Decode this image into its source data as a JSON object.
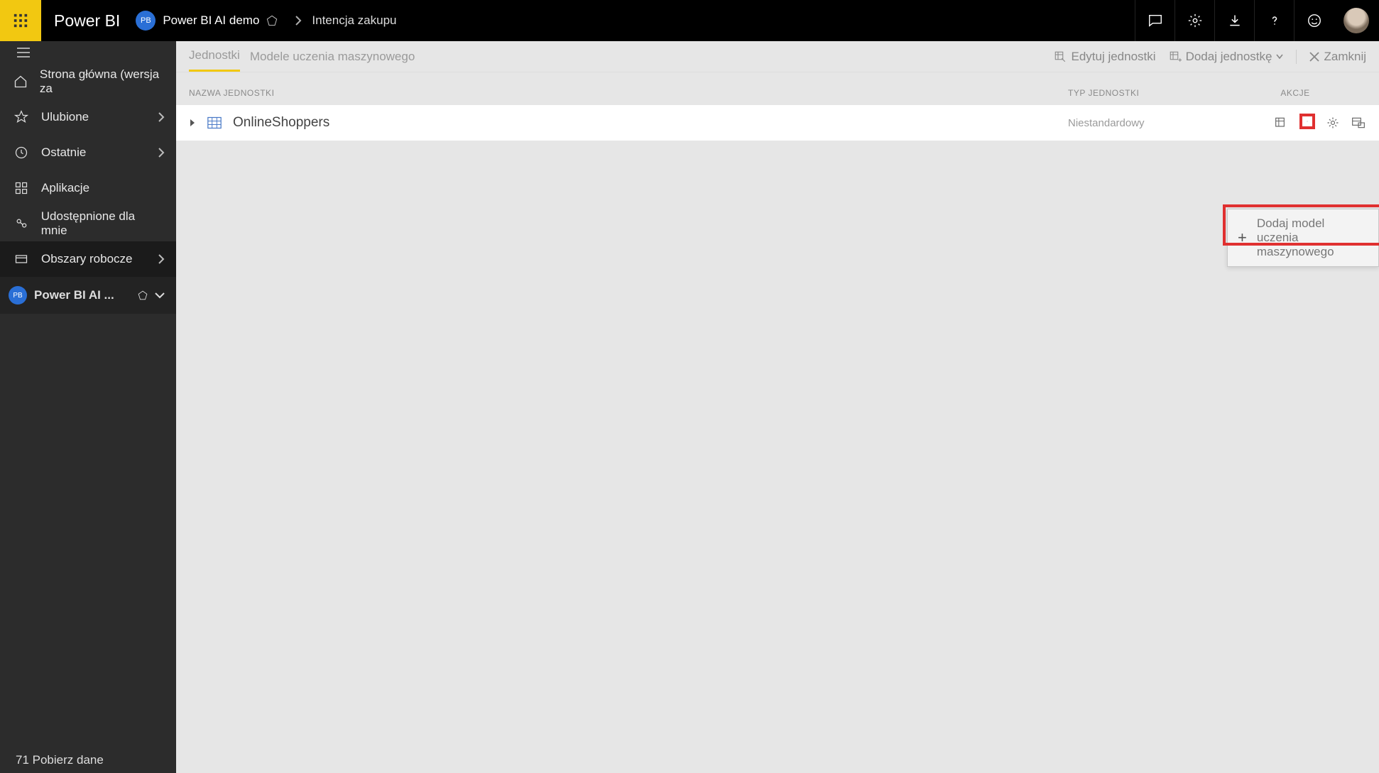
{
  "header": {
    "app_title": "Power BI",
    "workspace_badge": "PB",
    "workspace_name": "Power BI AI demo",
    "page_name": "Intencja zakupu"
  },
  "sidebar": {
    "items": [
      {
        "label": "Strona główna (wersja za"
      },
      {
        "label": "Ulubione"
      },
      {
        "label": "Ostatnie"
      },
      {
        "label": "Aplikacje"
      },
      {
        "label": "Udostępnione dla mnie"
      },
      {
        "label": "Obszary robocze"
      }
    ],
    "current_workspace_badge": "PB",
    "current_workspace": "Power BI AI ...",
    "footer": "71 Pobierz dane"
  },
  "tabs": {
    "tab1": "Jednostki",
    "tab2": "Modele uczenia maszynowego",
    "edit": "Edytuj jednostki",
    "add": "Dodaj jednostkę",
    "close": "Zamknij"
  },
  "columns": {
    "name": "NAZWA JEDNOSTKI",
    "type": "TYP JEDNOSTKI",
    "actions": "AKCJE"
  },
  "row": {
    "name": "OnlineShoppers",
    "type": "Niestandardowy"
  },
  "flyout": {
    "label": "Dodaj model uczenia maszynowego"
  }
}
